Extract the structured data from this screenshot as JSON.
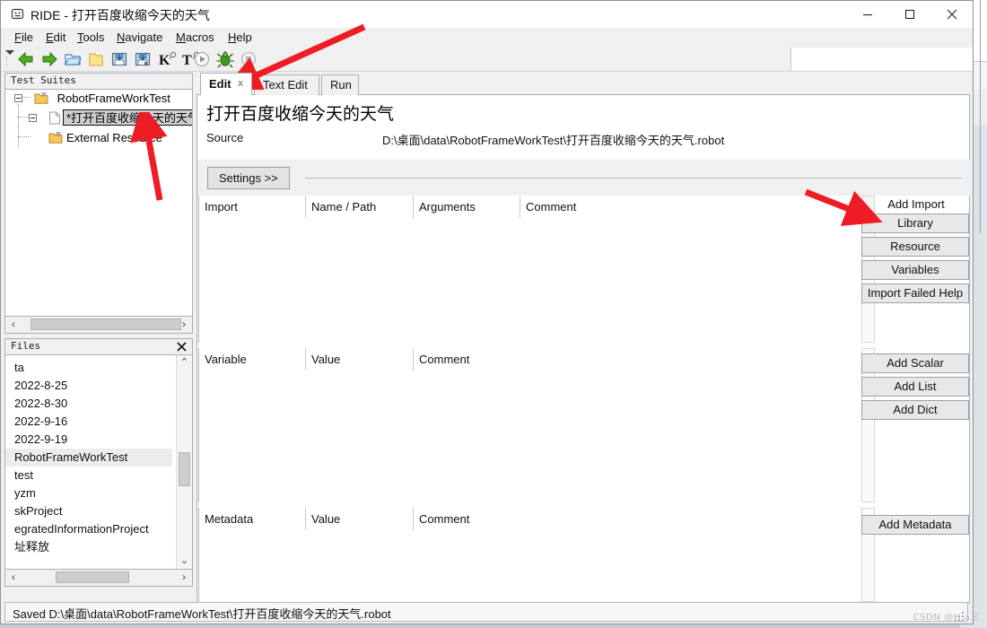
{
  "window": {
    "title": "RIDE - 打开百度收缩今天的天气",
    "app_icon": "app-icon",
    "minimize": "–",
    "maximize": "□",
    "close": "✕"
  },
  "menubar": {
    "items": [
      {
        "label": "File",
        "accel": "F"
      },
      {
        "label": "Edit",
        "accel": "E"
      },
      {
        "label": "Tools",
        "accel": "T"
      },
      {
        "label": "Navigate",
        "accel": "N"
      },
      {
        "label": "Macros",
        "accel": "M"
      },
      {
        "label": "Help",
        "accel": "H"
      }
    ]
  },
  "toolbar": {
    "items": [
      {
        "name": "back-icon",
        "glyph": "back"
      },
      {
        "name": "forward-icon",
        "glyph": "forward"
      },
      {
        "name": "open-directory-icon",
        "glyph": "open"
      },
      {
        "name": "new-project-icon",
        "glyph": "folder"
      },
      {
        "name": "save-icon",
        "glyph": "save"
      },
      {
        "name": "save-all-icon",
        "glyph": "saveall"
      },
      {
        "name": "search-keyword-icon",
        "glyph": "K"
      },
      {
        "name": "search-tests-icon",
        "glyph": "T"
      },
      {
        "name": "run-icon",
        "glyph": "run"
      },
      {
        "name": "debug-icon",
        "glyph": "bug"
      },
      {
        "name": "stop-icon",
        "glyph": "stop"
      }
    ]
  },
  "test_suites": {
    "panel_title": "Test Suites",
    "close_label": "✕",
    "nodes": [
      {
        "label": "RobotFrameWorkTest",
        "icon": "suite-icon",
        "selected": false,
        "level": 0,
        "expander": true
      },
      {
        "label": "*打开百度收缩今天的天气",
        "icon": "testcase-icon",
        "selected": true,
        "level": 1,
        "expander": true
      },
      {
        "label": "External Resource",
        "icon": "suite-icon",
        "selected": false,
        "level": 1,
        "expander": false
      }
    ],
    "hscroll": {
      "left_arrow": "‹",
      "right_arrow": "›"
    }
  },
  "files": {
    "panel_title": "Files",
    "close_label": "✕",
    "items": [
      {
        "label": "ta",
        "selected": false
      },
      {
        "label": "2022-8-25",
        "selected": false
      },
      {
        "label": "2022-8-30",
        "selected": false
      },
      {
        "label": "2022-9-16",
        "selected": false
      },
      {
        "label": "2022-9-19",
        "selected": false
      },
      {
        "label": "RobotFrameWorkTest",
        "selected": true
      },
      {
        "label": "test",
        "selected": false
      },
      {
        "label": "yzm",
        "selected": false
      },
      {
        "label": "skProject",
        "selected": false
      },
      {
        "label": "egratedInformationProject",
        "selected": false
      },
      {
        "label": "址释放",
        "selected": false
      }
    ],
    "hscroll": {
      "left_arrow": "‹",
      "right_arrow": "›"
    },
    "vscroll": {
      "up_arrow": "⌃",
      "down_arrow": "⌄"
    }
  },
  "tabs": [
    {
      "label": "Edit",
      "active": true,
      "closable": true,
      "close_label": "x"
    },
    {
      "label": "Text Edit",
      "active": false,
      "closable": false,
      "close_label": ""
    },
    {
      "label": "Run",
      "active": false,
      "closable": false,
      "close_label": ""
    }
  ],
  "document": {
    "title": "打开百度收缩今天的天气",
    "source_label": "Source",
    "source_value": "D:\\桌面\\data\\RobotFrameWorkTest\\打开百度收缩今天的天气.robot"
  },
  "settings": {
    "toggle_label": "Settings  >>"
  },
  "import_table": {
    "columns": [
      "Import",
      "Name / Path",
      "Arguments",
      "Comment"
    ],
    "rows": []
  },
  "variable_table": {
    "columns": [
      "Variable",
      "Value",
      "Comment"
    ],
    "rows": []
  },
  "metadata_table": {
    "columns": [
      "Metadata",
      "Value",
      "Comment"
    ],
    "rows": []
  },
  "side_actions": {
    "import_group_label": "Add Import",
    "import_buttons": [
      "Library",
      "Resource",
      "Variables",
      "Import Failed Help"
    ],
    "variable_buttons": [
      "Add Scalar",
      "Add List",
      "Add Dict"
    ],
    "metadata_buttons": [
      "Add Metadata"
    ]
  },
  "statusbar": {
    "message": "Saved D:\\桌面\\data\\RobotFrameWorkTest\\打开百度收缩今天的天气.robot"
  },
  "watermark": {
    "text": "CSDN @H a三"
  },
  "colors": {
    "accent_red": "#ee1c25",
    "window_bg": "#f0f0f0",
    "panel_border": "#a9b0b7",
    "selection": "#cfcfcf"
  }
}
